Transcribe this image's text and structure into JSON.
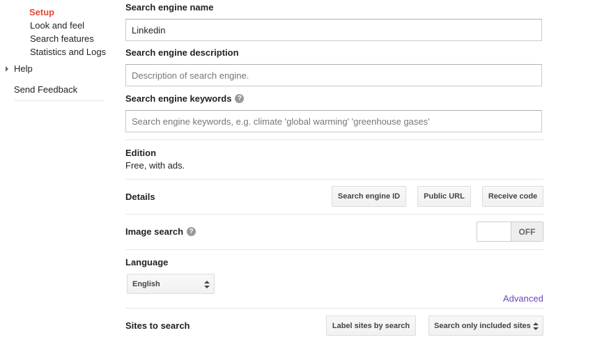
{
  "sidebar": {
    "items": [
      {
        "label": "Setup",
        "active": true
      },
      {
        "label": "Look and feel"
      },
      {
        "label": "Search features"
      },
      {
        "label": "Statistics and Logs"
      }
    ],
    "help_label": "Help",
    "feedback_label": "Send Feedback"
  },
  "form": {
    "name": {
      "label": "Search engine name",
      "value": "Linkedin"
    },
    "description": {
      "label": "Search engine description",
      "placeholder": "Description of search engine."
    },
    "keywords": {
      "label": "Search engine keywords",
      "placeholder": "Search engine keywords, e.g. climate 'global warming' 'greenhouse gases'"
    },
    "help_glyph": "?"
  },
  "edition": {
    "label": "Edition",
    "value": "Free, with ads."
  },
  "details": {
    "label": "Details",
    "buttons": [
      "Search engine ID",
      "Public URL",
      "Receive code"
    ]
  },
  "image_search": {
    "label": "Image search",
    "state": "OFF"
  },
  "language": {
    "label": "Language",
    "selected": "English"
  },
  "advanced_link": "Advanced",
  "sites": {
    "label": "Sites to search",
    "label_sites_button": "Label sites by search",
    "mode_selected": "Search only included sites"
  },
  "colors": {
    "active_nav": "#dd4b39",
    "link": "#6b46c1"
  }
}
